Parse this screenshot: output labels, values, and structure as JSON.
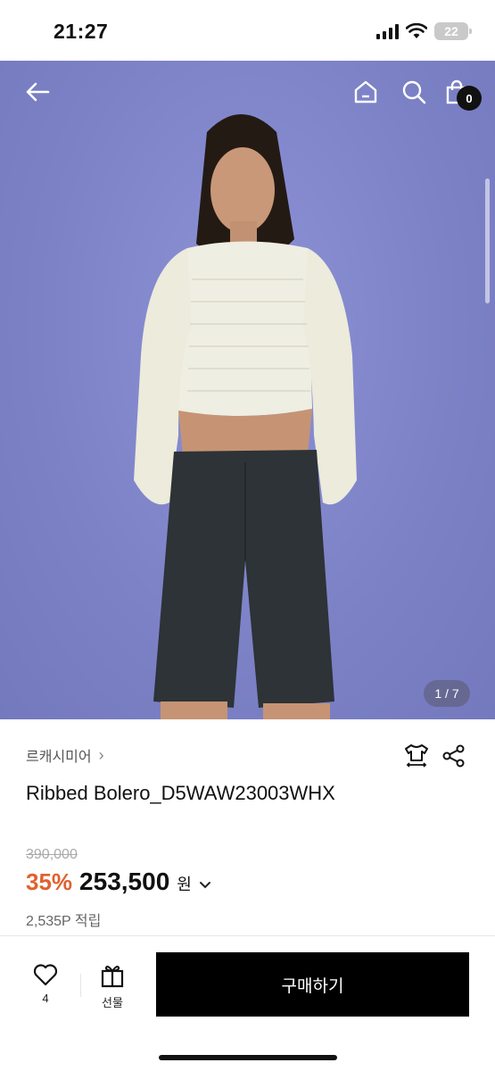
{
  "status": {
    "time": "21:27",
    "battery": "22"
  },
  "hero": {
    "image_label": "product photo",
    "pager": "1 / 7",
    "cart_count": "0"
  },
  "product": {
    "brand": "르캐시미어",
    "name": "Ribbed Bolero_D5WAW23003WHX",
    "original_price": "390,000",
    "discount": "35%",
    "price": "253,500",
    "currency": "원",
    "points": "2,535P 적립"
  },
  "bottom": {
    "like_count": "4",
    "gift_label": "선물",
    "buy_label": "구매하기"
  },
  "colors": {
    "accent_discount": "#e0612f",
    "hero_bg": "#7f84c9"
  }
}
